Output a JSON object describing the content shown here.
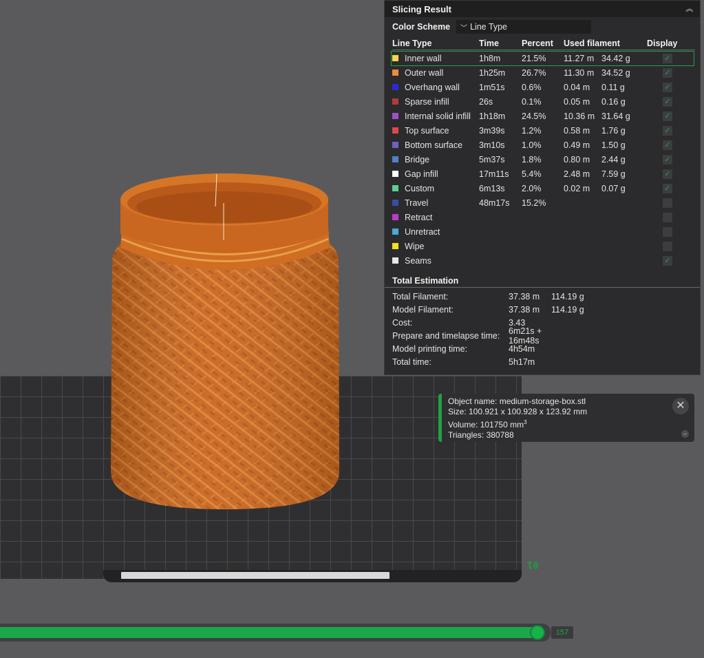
{
  "panel": {
    "title": "Slicing Result",
    "color_scheme_label": "Color Scheme",
    "color_scheme_value": "Line Type",
    "columns": [
      "Line Type",
      "Time",
      "Percent",
      "Used filament",
      "Display"
    ],
    "rows": [
      {
        "name": "Inner wall",
        "color": "#f2d74a",
        "time": "1h8m",
        "percent": "21.5%",
        "length": "11.27 m",
        "weight": "34.42 g",
        "display": true
      },
      {
        "name": "Outer wall",
        "color": "#f08a3c",
        "time": "1h25m",
        "percent": "26.7%",
        "length": "11.30 m",
        "weight": "34.52 g",
        "display": true
      },
      {
        "name": "Overhang wall",
        "color": "#2a2ad6",
        "time": "1m51s",
        "percent": "0.6%",
        "length": "0.04 m",
        "weight": "0.11 g",
        "display": true
      },
      {
        "name": "Sparse infill",
        "color": "#b23a3a",
        "time": "26s",
        "percent": "0.1%",
        "length": "0.05 m",
        "weight": "0.16 g",
        "display": true
      },
      {
        "name": "Internal solid infill",
        "color": "#a050c8",
        "time": "1h18m",
        "percent": "24.5%",
        "length": "10.36 m",
        "weight": "31.64 g",
        "display": true
      },
      {
        "name": "Top surface",
        "color": "#e04848",
        "time": "3m39s",
        "percent": "1.2%",
        "length": "0.58 m",
        "weight": "1.76 g",
        "display": true
      },
      {
        "name": "Bottom surface",
        "color": "#7060c0",
        "time": "3m10s",
        "percent": "1.0%",
        "length": "0.49 m",
        "weight": "1.50 g",
        "display": true
      },
      {
        "name": "Bridge",
        "color": "#4f82c8",
        "time": "5m37s",
        "percent": "1.8%",
        "length": "0.80 m",
        "weight": "2.44 g",
        "display": true
      },
      {
        "name": "Gap infill",
        "color": "#ffffff",
        "time": "17m11s",
        "percent": "5.4%",
        "length": "2.48 m",
        "weight": "7.59 g",
        "display": true
      },
      {
        "name": "Custom",
        "color": "#5ccf8f",
        "time": "6m13s",
        "percent": "2.0%",
        "length": "0.02 m",
        "weight": "0.07 g",
        "display": true
      },
      {
        "name": "Travel",
        "color": "#3a4fa0",
        "time": "48m17s",
        "percent": "15.2%",
        "length": "",
        "weight": "",
        "display": false
      },
      {
        "name": "Retract",
        "color": "#c03ac8",
        "time": "",
        "percent": "",
        "length": "",
        "weight": "",
        "display": false
      },
      {
        "name": "Unretract",
        "color": "#4aa8d8",
        "time": "",
        "percent": "",
        "length": "",
        "weight": "",
        "display": false
      },
      {
        "name": "Wipe",
        "color": "#f0e020",
        "time": "",
        "percent": "",
        "length": "",
        "weight": "",
        "display": false
      },
      {
        "name": "Seams",
        "color": "#e8e8e8",
        "time": "",
        "percent": "",
        "length": "",
        "weight": "",
        "display": true
      }
    ],
    "estimation_title": "Total Estimation",
    "estimation": [
      {
        "label": "Total Filament:",
        "v1": "37.38 m",
        "v2": "114.19 g"
      },
      {
        "label": "Model Filament:",
        "v1": "37.38 m",
        "v2": "114.19 g"
      },
      {
        "label": "Cost:",
        "v1": "3.43",
        "v2": ""
      },
      {
        "label": "Prepare and timelapse time:",
        "v1": "6m21s + 16m48s",
        "v2": ""
      },
      {
        "label": "Model printing time:",
        "v1": "4h54m",
        "v2": ""
      },
      {
        "label": "Total time:",
        "v1": "5h17m",
        "v2": ""
      }
    ]
  },
  "object_info": {
    "name": "Object name: medium-storage-box.stl",
    "size": "Size: 100.921 x 100.928 x 123.92 mm",
    "volume": "Volume: 101750 mm",
    "volume_unit_sup": "3",
    "triangles": "Triangles: 380788"
  },
  "layer_slider": {
    "value": "157",
    "accent": "#19a84a"
  },
  "plate": {
    "number": "01"
  },
  "colors": {
    "model": "#c8641c",
    "model_light": "#e28a3a",
    "accent": "#27a047"
  }
}
